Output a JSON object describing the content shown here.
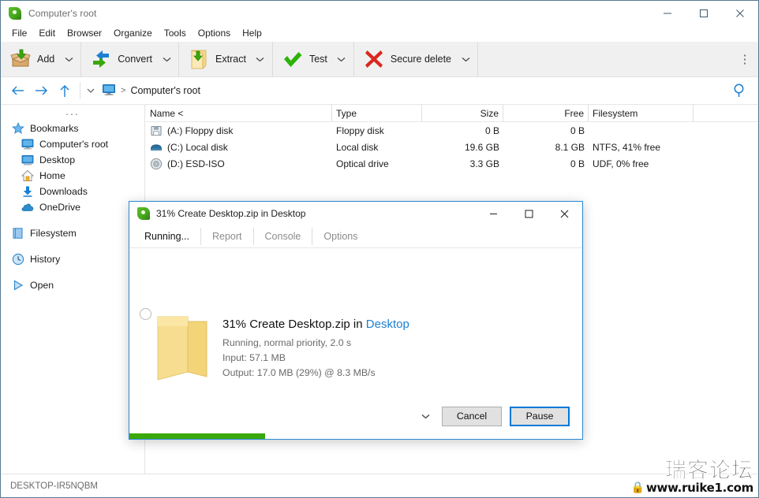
{
  "window": {
    "title": "Computer's root",
    "icon": "peazip-logo-icon",
    "minimize": "minimize-icon",
    "maximize": "maximize-icon",
    "close": "close-icon"
  },
  "menubar": {
    "items": [
      {
        "label": "File"
      },
      {
        "label": "Edit"
      },
      {
        "label": "Browser"
      },
      {
        "label": "Organize"
      },
      {
        "label": "Tools"
      },
      {
        "label": "Options"
      },
      {
        "label": "Help"
      }
    ]
  },
  "toolbar": {
    "buttons": [
      {
        "label": "Add",
        "icon": "add-box-icon",
        "has_dropdown": true
      },
      {
        "label": "Convert",
        "icon": "convert-arrows-icon",
        "has_dropdown": true
      },
      {
        "label": "Extract",
        "icon": "extract-folder-icon",
        "has_dropdown": true
      },
      {
        "label": "Test",
        "icon": "check-mark-icon",
        "has_dropdown": true
      },
      {
        "label": "Secure delete",
        "icon": "red-x-icon",
        "has_dropdown": true
      }
    ],
    "overflow": "overflow-menu-icon"
  },
  "addressbar": {
    "back": "back-arrow-icon",
    "forward": "forward-arrow-icon",
    "up": "up-arrow-icon",
    "history_chevron": "chevron-down-icon",
    "root_icon": "computer-monitor-icon",
    "separator": ">",
    "path": "Computer's root",
    "search": "search-icon"
  },
  "sidebar": {
    "overflow": "...",
    "items": [
      {
        "label": "Bookmarks",
        "icon": "star-icon",
        "indent": false
      },
      {
        "label": "Computer's root",
        "icon": "computer-monitor-icon",
        "indent": true
      },
      {
        "label": "Desktop",
        "icon": "desktop-monitor-icon",
        "indent": true
      },
      {
        "label": "Home",
        "icon": "home-icon",
        "indent": true
      },
      {
        "label": "Downloads",
        "icon": "download-arrow-icon",
        "indent": true
      },
      {
        "label": "OneDrive",
        "icon": "cloud-icon",
        "indent": true
      },
      {
        "label": "Filesystem",
        "icon": "filesystem-icon",
        "indent": false,
        "gap_before": true
      },
      {
        "label": "History",
        "icon": "clock-icon",
        "indent": false,
        "gap_before": true
      },
      {
        "label": "Open",
        "icon": "play-triangle-icon",
        "indent": false,
        "gap_before": true
      }
    ]
  },
  "filelist": {
    "columns": [
      {
        "label": "Name <",
        "align": "left"
      },
      {
        "label": "Type",
        "align": "left"
      },
      {
        "label": "Size",
        "align": "right"
      },
      {
        "label": "Free",
        "align": "right"
      },
      {
        "label": "Filesystem",
        "align": "left"
      },
      {
        "label": "",
        "align": "left"
      }
    ],
    "rows": [
      {
        "icon": "floppy-disk-icon",
        "name": "(A:) Floppy disk",
        "type": "Floppy disk",
        "size": "0 B",
        "free": "0 B",
        "filesystem": ""
      },
      {
        "icon": "hard-disk-icon",
        "name": "(C:) Local disk",
        "type": "Local disk",
        "size": "19.6 GB",
        "free": "8.1 GB",
        "filesystem": "NTFS, 41% free"
      },
      {
        "icon": "optical-disc-icon",
        "name": "(D:) ESD-ISO",
        "type": "Optical drive",
        "size": "3.3 GB",
        "free": "0 B",
        "filesystem": "UDF, 0% free"
      }
    ]
  },
  "statusbar": {
    "text": "DESKTOP-IR5NQBM"
  },
  "watermark": {
    "cn": "瑞客论坛",
    "url": "www.ruike1.com",
    "lock": "lock-icon"
  },
  "dialog": {
    "title": "31% Create Desktop.zip in Desktop",
    "icon": "peazip-logo-icon",
    "minimize": "minimize-icon",
    "maximize": "maximize-icon",
    "close": "close-icon",
    "tabs": [
      {
        "label": "Running...",
        "active": true
      },
      {
        "label": "Report",
        "active": false
      },
      {
        "label": "Console",
        "active": false
      },
      {
        "label": "Options",
        "active": false
      }
    ],
    "spinner": "spinner-icon",
    "folder_icon": "folder-icon",
    "heading_prefix": "31% Create Desktop.zip in ",
    "heading_link": "Desktop",
    "line1": "Running, normal priority, 2.0 s",
    "line2": "Input: 57.1 MB",
    "line3": "Output: 17.0 MB (29%) @ 8.3 MB/s",
    "footer_chevron": "chevron-down-icon",
    "cancel_label": "Cancel",
    "pause_label": "Pause",
    "progress_percent": 30,
    "progress_color": "#3aa80c"
  }
}
